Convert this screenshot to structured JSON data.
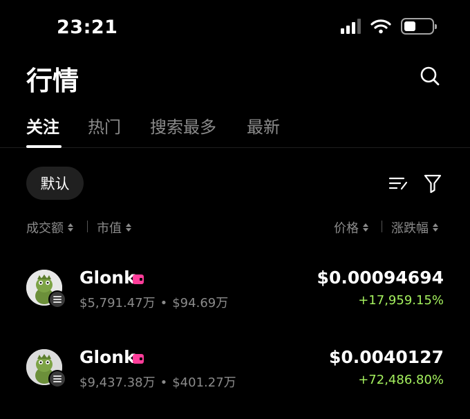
{
  "status_bar": {
    "time": "23:21"
  },
  "header": {
    "title": "行情"
  },
  "tabs": [
    {
      "label": "关注",
      "active": true
    },
    {
      "label": "热门",
      "active": false
    },
    {
      "label": "搜索最多",
      "active": false
    },
    {
      "label": "最新",
      "active": false
    }
  ],
  "filter_chip": "默认",
  "columns": {
    "volume": "成交额",
    "market_cap": "市值",
    "price": "价格",
    "change": "涨跌幅"
  },
  "tokens": [
    {
      "name": "Glonk",
      "volume": "$5,791.47万",
      "market_cap": "$94.69万",
      "price": "$0.00094694",
      "change": "+17,959.15%"
    },
    {
      "name": "Glonk",
      "volume": "$9,437.38万",
      "market_cap": "$401.27万",
      "price": "$0.0040127",
      "change": "+72,486.80%"
    }
  ],
  "colors": {
    "background": "#000000",
    "positive": "#a4f05e",
    "muted": "#8b8b8b",
    "wallet_tag": "#ff3d9a"
  },
  "icons": [
    "search-icon",
    "sort-list-icon",
    "filter-icon",
    "wallet-icon",
    "chain-icon",
    "signal-icon",
    "wifi-icon",
    "battery-icon"
  ]
}
